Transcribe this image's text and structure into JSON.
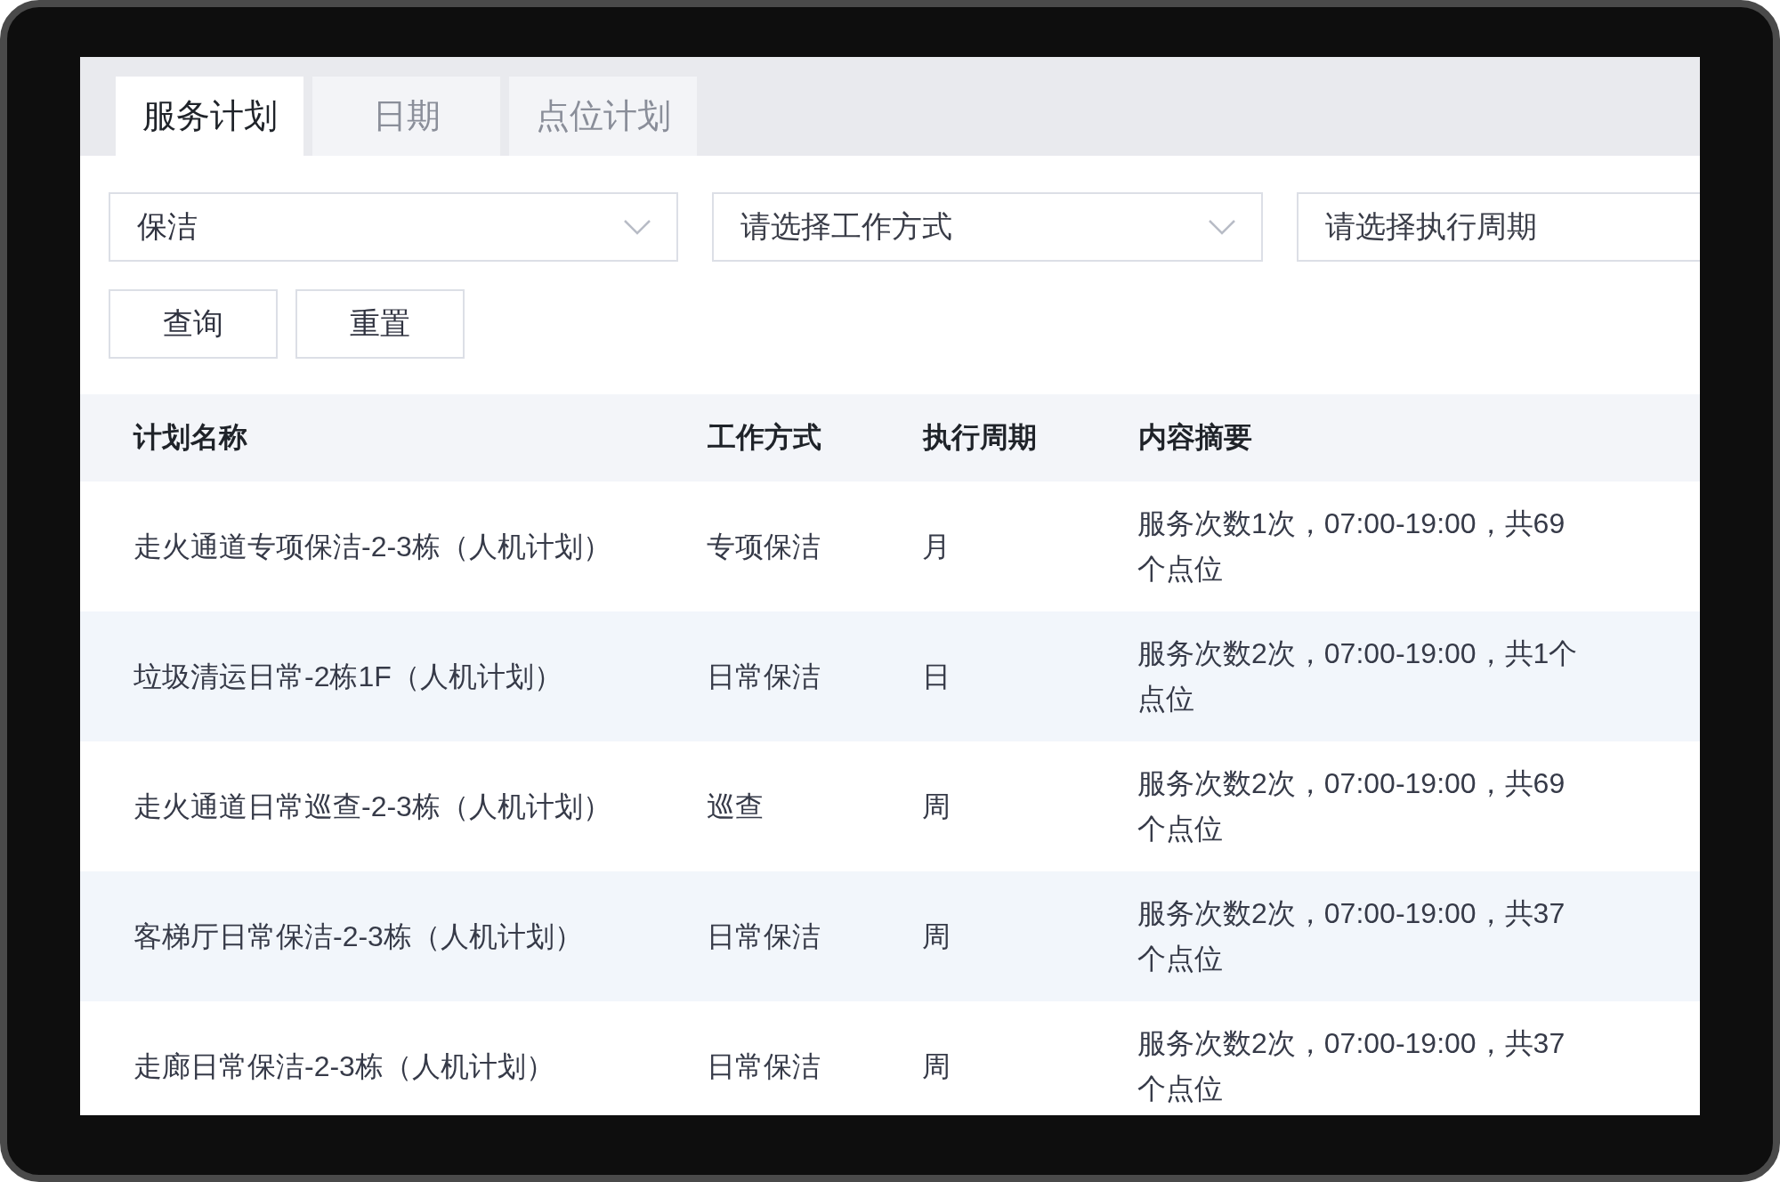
{
  "tabs": [
    {
      "label": "服务计划",
      "selected": true
    },
    {
      "label": "日期",
      "selected": false
    },
    {
      "label": "点位计划",
      "selected": false
    }
  ],
  "filters": [
    {
      "value": "保洁"
    },
    {
      "placeholder": "请选择工作方式"
    },
    {
      "placeholder": "请选择执行周期"
    }
  ],
  "buttons": [
    "查询",
    "重置"
  ],
  "table": {
    "columns": [
      "计划名称",
      "工作方式",
      "执行周期",
      "内容摘要"
    ],
    "rows": [
      [
        "走火通道专项保洁-2-3栋（人机计划）",
        "专项保洁",
        "月",
        "服务次数1次，07:00-19:00，共69个点位"
      ],
      [
        "垃圾清运日常-2栋1F（人机计划）",
        "日常保洁",
        "日",
        "服务次数2次，07:00-19:00，共1个点位"
      ],
      [
        "走火通道日常巡查-2-3栋（人机计划）",
        "巡查",
        "周",
        "服务次数2次，07:00-19:00，共69个点位"
      ],
      [
        "客梯厅日常保洁-2-3栋（人机计划）",
        "日常保洁",
        "周",
        "服务次数2次，07:00-19:00，共37个点位"
      ],
      [
        "走廊日常保洁-2-3栋（人机计划）",
        "日常保洁",
        "周",
        "服务次数2次，07:00-19:00，共37个点位"
      ]
    ]
  }
}
